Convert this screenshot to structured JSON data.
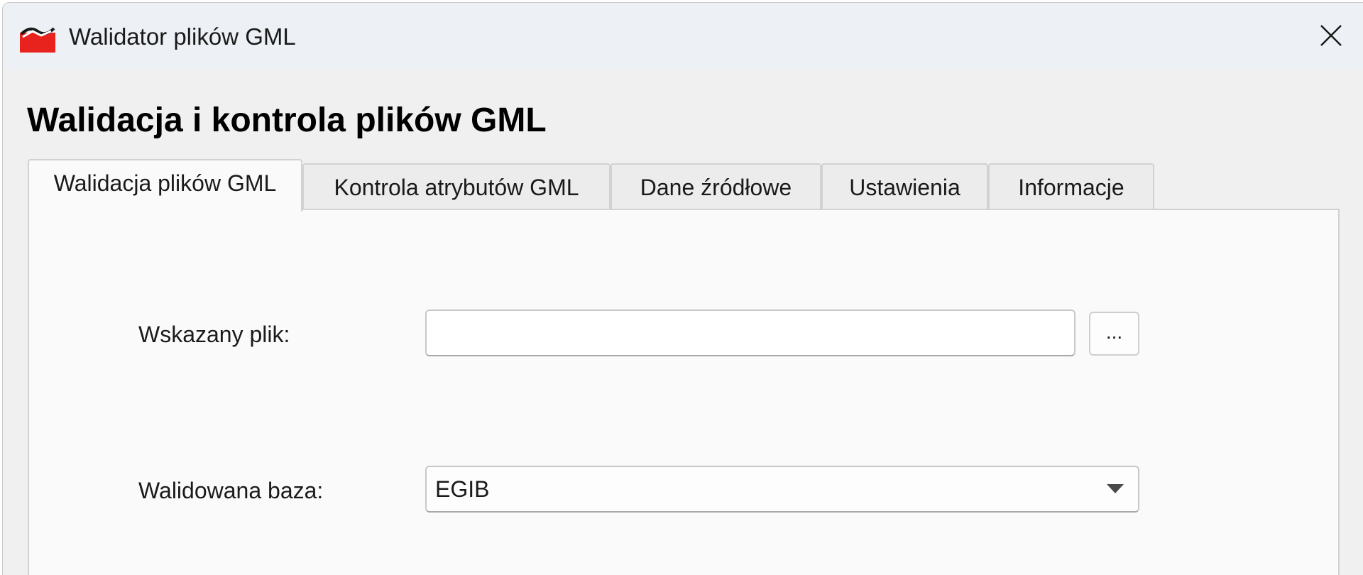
{
  "window": {
    "title": "Walidator plików GML",
    "app_icon": "red-toolbox-icon",
    "close_icon": "close-icon"
  },
  "heading": "Walidacja i kontrola plików GML",
  "tabs": [
    {
      "label": "Walidacja plików GML",
      "active": true
    },
    {
      "label": "Kontrola atrybutów GML",
      "active": false
    },
    {
      "label": "Dane źródłowe",
      "active": false
    },
    {
      "label": "Ustawienia",
      "active": false
    },
    {
      "label": "Informacje",
      "active": false
    }
  ],
  "form": {
    "file_label": "Wskazany plik:",
    "file_value": "",
    "browse_label": "...",
    "base_label": "Walidowana baza:",
    "base_selected": "EGIB"
  },
  "colors": {
    "titlebar": "#edf1f6",
    "window_bg": "#f0f0f0",
    "panel_bg": "#fafafa",
    "icon_red": "#e8221c"
  }
}
